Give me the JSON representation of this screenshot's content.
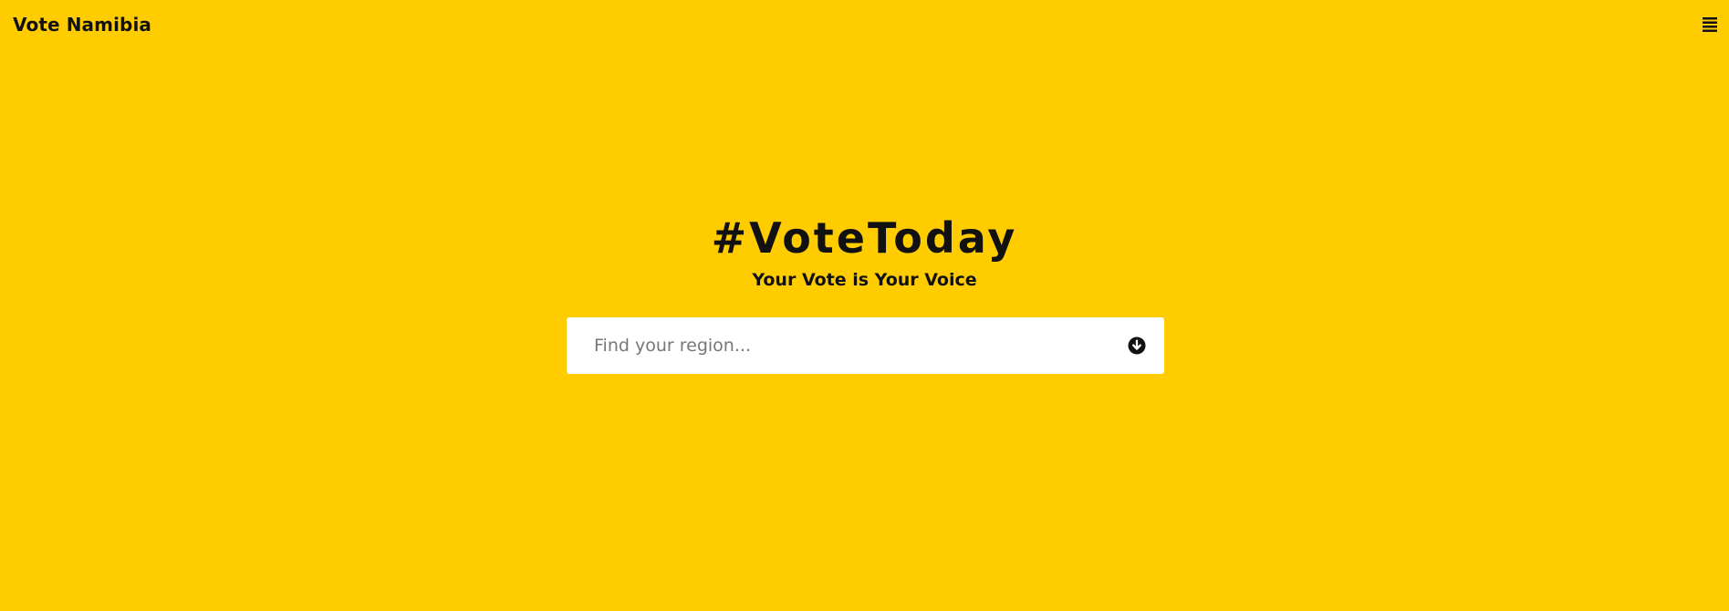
{
  "header": {
    "brand": "Vote Namibia",
    "menu_icon": "hamburger-menu-icon"
  },
  "hero": {
    "title": "#VoteToday",
    "subtitle": "Your Vote is Your Voice"
  },
  "search": {
    "placeholder": "Find your region...",
    "value": "",
    "submit_icon": "arrow-down-circle-icon"
  },
  "colors": {
    "background": "#ffcc00",
    "text": "#111111",
    "input_background": "#ffffff"
  }
}
